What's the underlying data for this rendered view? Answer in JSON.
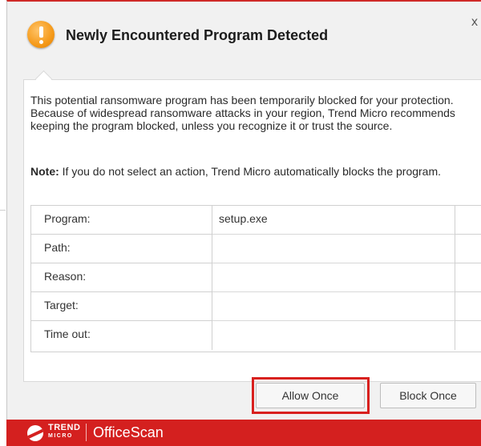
{
  "header": {
    "title": "Newly Encountered Program Detected",
    "icon": "warning-icon",
    "close_glyph": "x"
  },
  "message": {
    "description": "This potential ransomware program has been temporarily blocked for your protection. Because of widespread ransomware attacks in your region, Trend Micro recommends keeping the program blocked, unless you recognize it or trust the source.",
    "note_label": "Note:",
    "note_text": " If you do not select an action, Trend Micro automatically blocks the program."
  },
  "details": {
    "rows": [
      {
        "label": "Program:",
        "value": "setup.exe"
      },
      {
        "label": "Path:",
        "value": ""
      },
      {
        "label": "Reason:",
        "value": ""
      },
      {
        "label": "Target:",
        "value": ""
      },
      {
        "label": "Time out:",
        "value": ""
      }
    ]
  },
  "actions": {
    "allow_label": "Allow Once",
    "block_label": "Block Once"
  },
  "footer": {
    "brand_top": "TREND",
    "brand_bottom": "MICRO",
    "product": "OfficeScan"
  },
  "colors": {
    "brand_red": "#d4201f",
    "warning_orange": "#f59a1a",
    "highlight_outline": "#d8201e"
  }
}
